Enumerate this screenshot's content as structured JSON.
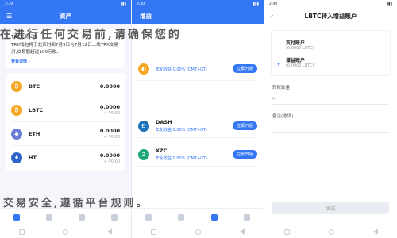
{
  "s1": {
    "status_time": "2:39",
    "title": "资产",
    "notice": {
      "title": "TRX交易公告",
      "text": "TRX钱包将于北京时间7月9日与7月12日上线TRX交易对,交易额超过100万枚。",
      "link": "查看详情 ›"
    },
    "assets": [
      {
        "symbol": "BTC",
        "amount": "0.0000",
        "color": "#f5a623",
        "glyph": "₿"
      },
      {
        "symbol": "LBTC",
        "amount": "0.0000",
        "value": "≈ ¥0.00",
        "color": "#f5a623",
        "glyph": "₿"
      },
      {
        "symbol": "ETH",
        "amount": "0.0000",
        "value": "≈ ¥0.00",
        "color": "#6b7fd7",
        "glyph": "◆"
      },
      {
        "symbol": "HT",
        "amount": "0.0000",
        "value": "≈ ¥0.00",
        "color": "#2f64c8",
        "glyph": "♦"
      }
    ]
  },
  "s2": {
    "status_time": "2:40",
    "title": "增益",
    "items": [
      {
        "name": "",
        "rate": "年化收益 0.00% (CMT+GT)",
        "button": "立即开通",
        "color": "#f5a623",
        "glyph": "◐"
      },
      {
        "name": "DASH",
        "rate": "年化收益 0.00% (CMT+GT)",
        "button": "立即开通",
        "color": "#1c75bc",
        "glyph": "Đ"
      },
      {
        "name": "XZC",
        "rate": "年化收益 0.00% (CMT+GT)",
        "button": "立即开通",
        "color": "#1aa87a",
        "glyph": "Z"
      }
    ]
  },
  "s3": {
    "status_time": "2:40",
    "title": "LBTC转入增益账户",
    "from_label": "支付账户",
    "from_value": "(0.0000 LBTC)",
    "to_label": "增益账户",
    "to_value": "(0.0000 LBTC)",
    "amount_label": "转账数量",
    "amount_placeholder": "0",
    "note_label": "备注(选填)",
    "send_button": "发送"
  },
  "watermark": {
    "top": "在进行任何交易前,请确保您的",
    "bottom": "交易安全,遵循平台规则。"
  }
}
